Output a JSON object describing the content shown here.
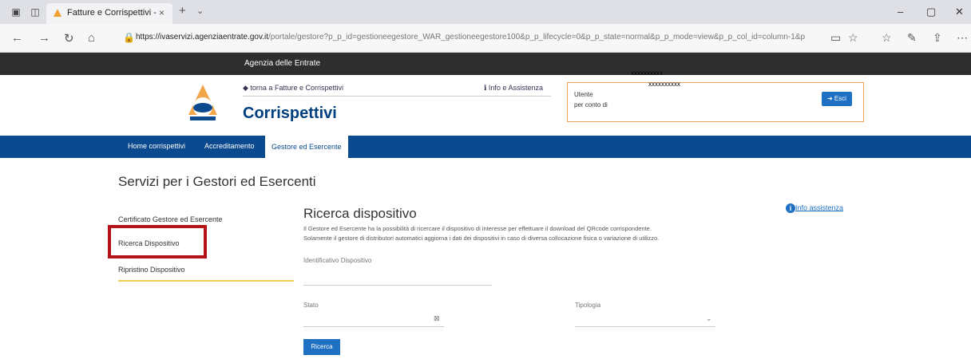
{
  "browser": {
    "tab_title": "Fatture e Corrispettivi -",
    "tab_close": "×",
    "new_tab": "+",
    "url_host": "https://ivaservizi.agenziaentrate.gov.it",
    "url_path": "/portale/gestore?p_p_id=gestioneegestore_WAR_gestioneegestore100&p_p_lifecycle=0&p_p_state=normal&p_p_mode=view&p_p_col_id=column-1&p",
    "icons": [
      "tab-actions-icon",
      "back-tabs-icon",
      "back-icon",
      "forward-icon",
      "refresh-icon",
      "home-icon",
      "lock-icon",
      "favorite-icon",
      "favorites-icon",
      "pen-icon",
      "share-icon",
      "more-icon"
    ]
  },
  "site": {
    "agency": "Agenzia delle Entrate",
    "back_link": "◆ torna a Fatture e Corrispettivi",
    "info_link": "Info e Assistenza",
    "app_title": "Corrispettivi",
    "user_label": "Utente",
    "on_behalf_label": "per conto di",
    "exit_button": "➜ Esci",
    "masked_1": "xxxxxxxxxx",
    "masked_2": "xxxxxxxxxx"
  },
  "nav": {
    "items": [
      "Home corrispettivi",
      "Accreditamento",
      "Gestore ed Esercente"
    ]
  },
  "main": {
    "page_title": "Servizi per i Gestori ed Esercenti",
    "side_menu": [
      "Certificato Gestore ed Esercente",
      "Ricerca Dispositivo",
      "Ripristino Dispositivo"
    ],
    "section_title": "Ricerca dispositivo",
    "assist_link": "Info assistenza",
    "description_1": "Il Gestore ed Esercente ha la possibilità di ricercare il dispositivo di interesse per effettuare il download del QRcode corrispondente.",
    "description_2": "Solamente il gestore di distributori automatici aggiorna i dati dei dispositivi in caso di diversa collocazione fisica o variazione di utilizzo.",
    "field_id_label": "Identificativo Dispositivo",
    "field_status_label": "Stato",
    "field_type_label": "Tipologia",
    "search_button": "Ricerca"
  },
  "colors": {
    "brand_blue": "#0b4a8e",
    "accent_blue": "#1e70c2",
    "highlight_red": "#b31217",
    "user_box_border": "#f0a35e"
  }
}
